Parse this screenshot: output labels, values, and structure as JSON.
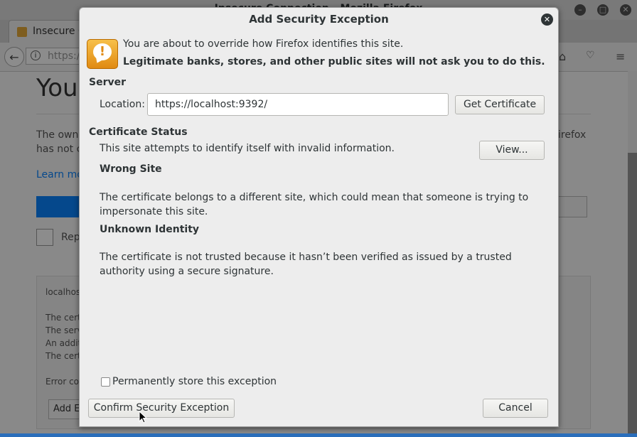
{
  "background": {
    "window_title": "Insecure Connection - Mozilla Firefox",
    "tab_label": "Insecure C",
    "url_fragment": "https://",
    "heading_fragment": "You",
    "text_line1": "The owne",
    "text_line2": "has not c",
    "text_right": "irefox",
    "learn_more": "Learn mo",
    "report_label": "Rep",
    "panel_lines": [
      "localhos",
      "The cert",
      "The serv",
      "An addit",
      "The cert",
      "Error co"
    ],
    "panel_button": "Add E"
  },
  "dialog": {
    "title": "Add Security Exception",
    "intro_line1": "You are about to override how Firefox identifies this site.",
    "intro_line2": "Legitimate banks, stores, and other public sites will not ask you to do this.",
    "server_label": "Server",
    "location_label": "Location:",
    "location_value": "https://localhost:9392/",
    "get_certificate_label": "Get Certificate",
    "cert_status_label": "Certificate Status",
    "status_text": "This site attempts to identify itself with invalid information.",
    "view_label": "View...",
    "wrong_site_heading": "Wrong Site",
    "wrong_site_text": "The certificate belongs to a different site, which could mean that someone is trying to impersonate this site.",
    "unknown_identity_heading": "Unknown Identity",
    "unknown_identity_text": "The certificate is not trusted because it hasn’t been verified as issued by a trusted authority using a secure signature.",
    "permanent_label": "Permanently store this exception",
    "confirm_label": "Confirm Security Exception",
    "cancel_label": "Cancel"
  },
  "icons": {
    "warning": "warning-bubble-icon",
    "close": "close-icon",
    "back": "back-arrow-icon",
    "info": "info-icon",
    "home": "home-icon",
    "pocket": "pocket-icon",
    "menu": "hamburger-menu-icon",
    "cursor": "mouse-pointer-icon"
  }
}
